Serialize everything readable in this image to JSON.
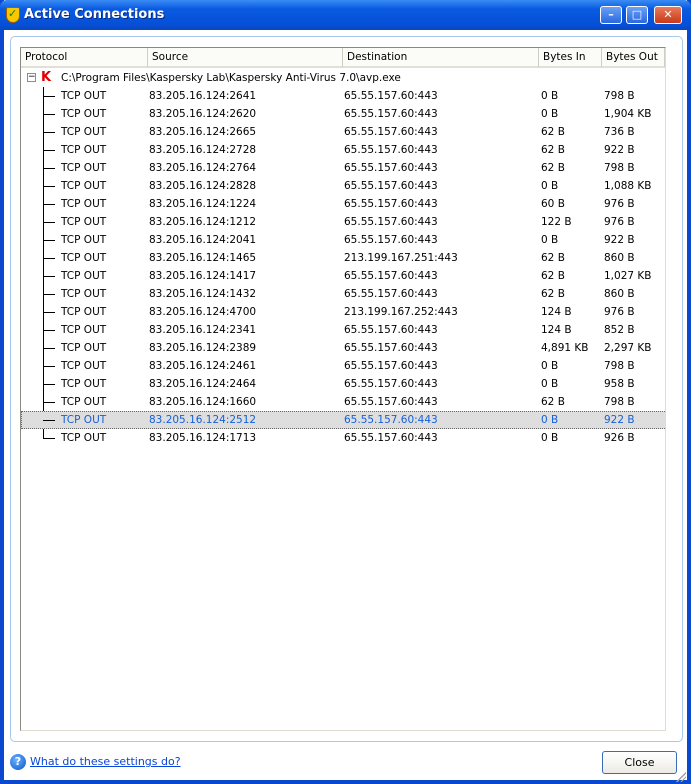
{
  "window": {
    "title": "Active Connections",
    "minimize": "–",
    "maximize": "□",
    "close": "✕"
  },
  "columns": [
    "Protocol",
    "Source",
    "Destination",
    "Bytes In",
    "Bytes Out"
  ],
  "process": {
    "path": "C:\\Program Files\\Kaspersky Lab\\Kaspersky Anti-Virus 7.0\\avp.exe",
    "expander": "−",
    "icon": "kaspersky-k-icon"
  },
  "connections": [
    [
      "TCP OUT",
      "83.205.16.124:2641",
      "65.55.157.60:443",
      "0 B",
      "798 B"
    ],
    [
      "TCP OUT",
      "83.205.16.124:2620",
      "65.55.157.60:443",
      "0 B",
      "1,904 KB"
    ],
    [
      "TCP OUT",
      "83.205.16.124:2665",
      "65.55.157.60:443",
      "62 B",
      "736 B"
    ],
    [
      "TCP OUT",
      "83.205.16.124:2728",
      "65.55.157.60:443",
      "62 B",
      "922 B"
    ],
    [
      "TCP OUT",
      "83.205.16.124:2764",
      "65.55.157.60:443",
      "62 B",
      "798 B"
    ],
    [
      "TCP OUT",
      "83.205.16.124:2828",
      "65.55.157.60:443",
      "0 B",
      "1,088 KB"
    ],
    [
      "TCP OUT",
      "83.205.16.124:1224",
      "65.55.157.60:443",
      "60 B",
      "976 B"
    ],
    [
      "TCP OUT",
      "83.205.16.124:1212",
      "65.55.157.60:443",
      "122 B",
      "976 B"
    ],
    [
      "TCP OUT",
      "83.205.16.124:2041",
      "65.55.157.60:443",
      "0 B",
      "922 B"
    ],
    [
      "TCP OUT",
      "83.205.16.124:1465",
      "213.199.167.251:443",
      "62 B",
      "860 B"
    ],
    [
      "TCP OUT",
      "83.205.16.124:1417",
      "65.55.157.60:443",
      "62 B",
      "1,027 KB"
    ],
    [
      "TCP OUT",
      "83.205.16.124:1432",
      "65.55.157.60:443",
      "62 B",
      "860 B"
    ],
    [
      "TCP OUT",
      "83.205.16.124:4700",
      "213.199.167.252:443",
      "124 B",
      "976 B"
    ],
    [
      "TCP OUT",
      "83.205.16.124:2341",
      "65.55.157.60:443",
      "124 B",
      "852 B"
    ],
    [
      "TCP OUT",
      "83.205.16.124:2389",
      "65.55.157.60:443",
      "4,891 KB",
      "2,297 KB"
    ],
    [
      "TCP OUT",
      "83.205.16.124:2461",
      "65.55.157.60:443",
      "0 B",
      "798 B"
    ],
    [
      "TCP OUT",
      "83.205.16.124:2464",
      "65.55.157.60:443",
      "0 B",
      "958 B"
    ],
    [
      "TCP OUT",
      "83.205.16.124:1660",
      "65.55.157.60:443",
      "62 B",
      "798 B"
    ],
    [
      "TCP OUT",
      "83.205.16.124:2512",
      "65.55.157.60:443",
      "0 B",
      "922 B"
    ],
    [
      "TCP OUT",
      "83.205.16.124:1713",
      "65.55.157.60:443",
      "0 B",
      "926 B"
    ]
  ],
  "selected_index": 18,
  "footer": {
    "help_icon": "?",
    "help_link": "What do these settings do?",
    "close_button": "Close"
  }
}
